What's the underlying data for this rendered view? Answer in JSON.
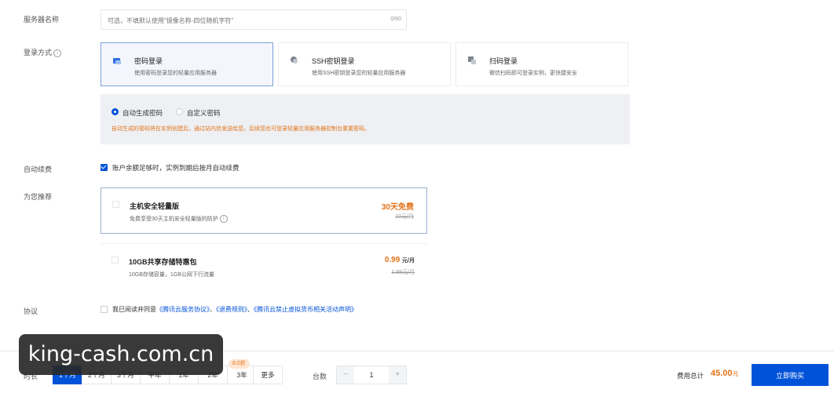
{
  "server_name": {
    "label": "服务器名称",
    "placeholder": "可选，不填默认使用“镜像名称-四位随机字符”",
    "counter": "0/60"
  },
  "login": {
    "label": "登录方式",
    "help_icon": "info-circle-icon",
    "options": [
      {
        "title": "密码登录",
        "desc": "使用密码登录您的轻量应用服务器",
        "icon": "password-icon",
        "selected": true
      },
      {
        "title": "SSH密钥登录",
        "desc": "使用SSH密钥登录您的轻量应用服务器",
        "icon": "key-icon",
        "selected": false
      },
      {
        "title": "扫码登录",
        "desc": "微信扫码即可登录实例，更快捷安全",
        "icon": "qrcode-icon",
        "selected": false
      }
    ],
    "password_mode": {
      "auto": "自动生成密码",
      "custom": "自定义密码",
      "selected": "auto",
      "tip": "自动生成的密码将在实例创建后，通过站内信发送给您。后续您也可登录轻量应用服务器控制台重置密码。"
    }
  },
  "auto_renew": {
    "label": "自动续费",
    "checked": true,
    "text": "账户余额足够时，实例到期后按月自动续费"
  },
  "recommend": {
    "label": "为您推荐",
    "items": [
      {
        "title": "主机安全轻量版",
        "desc": "免费享受30天主机安全轻量版的防护",
        "price": "30天免费",
        "unit": "",
        "original": "10元/月"
      },
      {
        "title": "10GB共享存储特惠包",
        "desc": "10GB存储容量，1GB公网下行流量",
        "price": "0.99",
        "unit": "元/月",
        "original": "1.98元/月"
      }
    ]
  },
  "agreement": {
    "label": "协议",
    "prefix": "我已阅读并同意",
    "link1": "《腾讯云服务协议》",
    "sep1": "、",
    "link2": "《退费规则》",
    "sep2": "、",
    "link3": "《腾讯云禁止虚拟货币相关活动声明》"
  },
  "bottom": {
    "duration_label": "时长",
    "durations": [
      "1个月",
      "2个月",
      "3个月",
      "半年",
      "1年",
      "2年",
      "3年",
      "更多"
    ],
    "selected_duration": "1个月",
    "discount_badge": "8.0折",
    "quantity_label": "台数",
    "quantity": "1",
    "minus": "−",
    "plus": "+",
    "total_label": "费用总计",
    "total_value": "45.00",
    "total_unit": "元",
    "buy_label": "立即购买"
  },
  "watermark": "king-cash.com.cn",
  "colors": {
    "primary": "#0052d9",
    "accent": "#e37318"
  }
}
